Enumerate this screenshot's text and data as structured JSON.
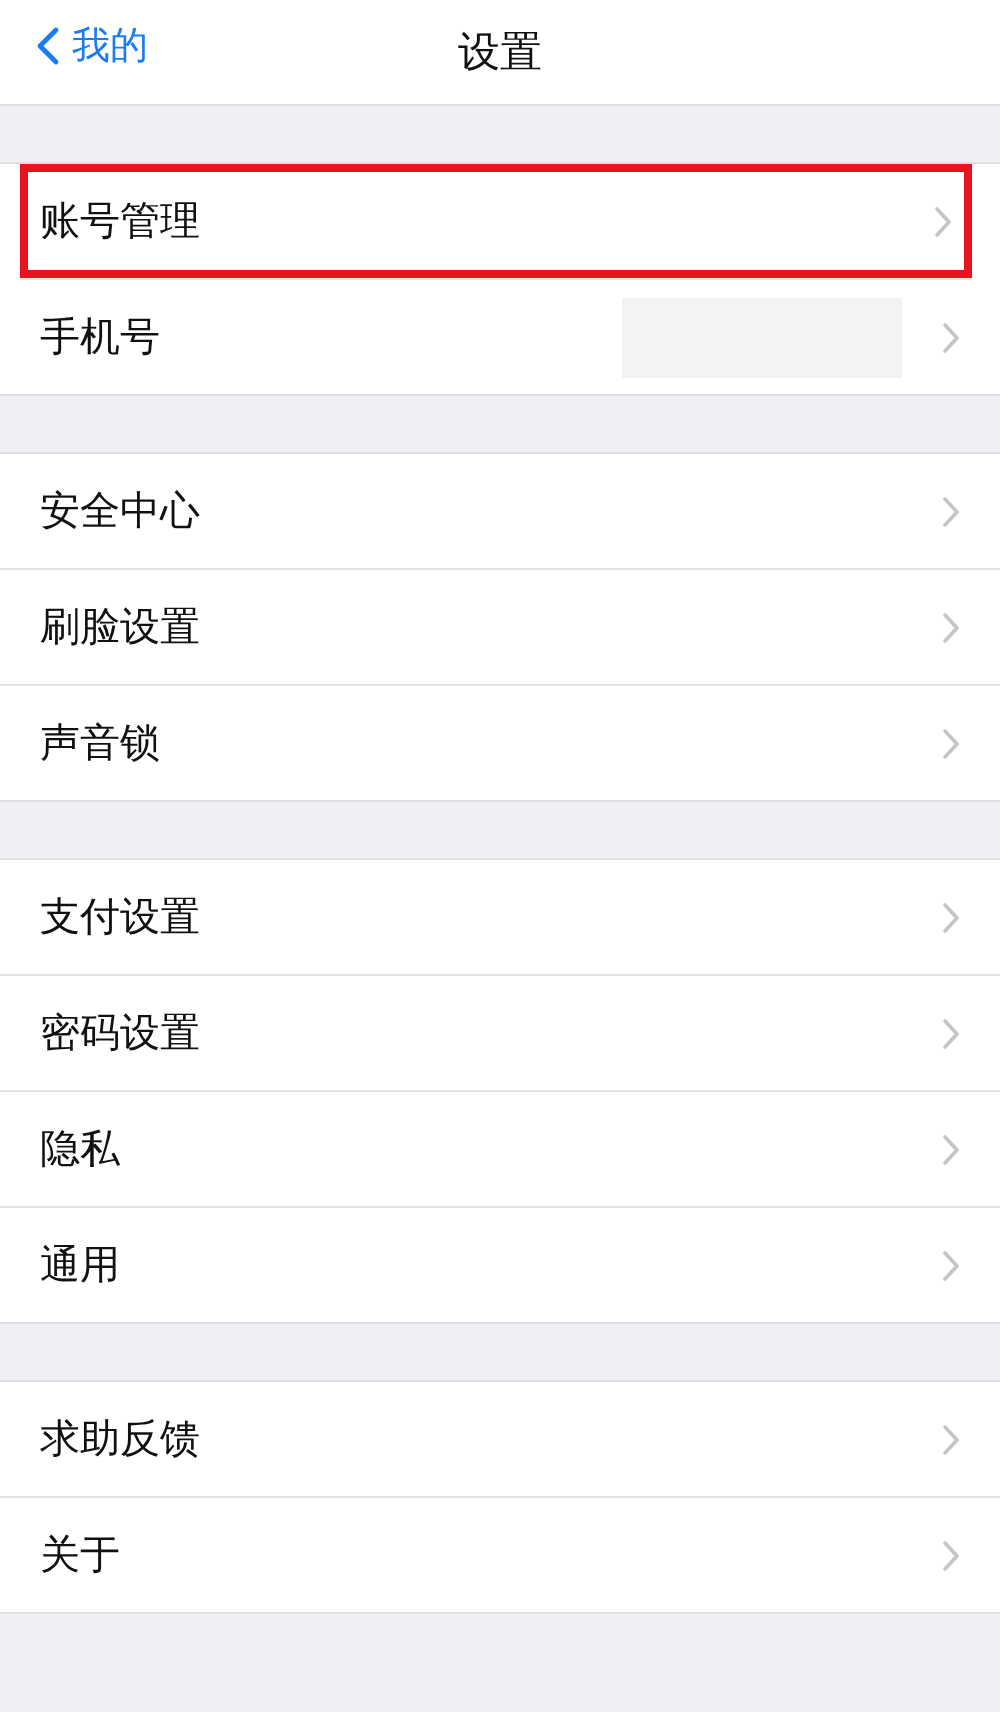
{
  "nav_bar": {
    "back_label": "我的",
    "title": "设置"
  },
  "groups": [
    {
      "items": [
        {
          "label": "账号管理",
          "highlighted": true,
          "redacted": false
        },
        {
          "label": "手机号",
          "highlighted": false,
          "redacted": true
        }
      ]
    },
    {
      "items": [
        {
          "label": "安全中心",
          "highlighted": false,
          "redacted": false
        },
        {
          "label": "刷脸设置",
          "highlighted": false,
          "redacted": false
        },
        {
          "label": "声音锁",
          "highlighted": false,
          "redacted": false
        }
      ]
    },
    {
      "items": [
        {
          "label": "支付设置",
          "highlighted": false,
          "redacted": false
        },
        {
          "label": "密码设置",
          "highlighted": false,
          "redacted": false
        },
        {
          "label": "隐私",
          "highlighted": false,
          "redacted": false
        },
        {
          "label": "通用",
          "highlighted": false,
          "redacted": false
        }
      ]
    },
    {
      "items": [
        {
          "label": "求助反馈",
          "highlighted": false,
          "redacted": false
        },
        {
          "label": "关于",
          "highlighted": false,
          "redacted": false
        }
      ]
    }
  ]
}
